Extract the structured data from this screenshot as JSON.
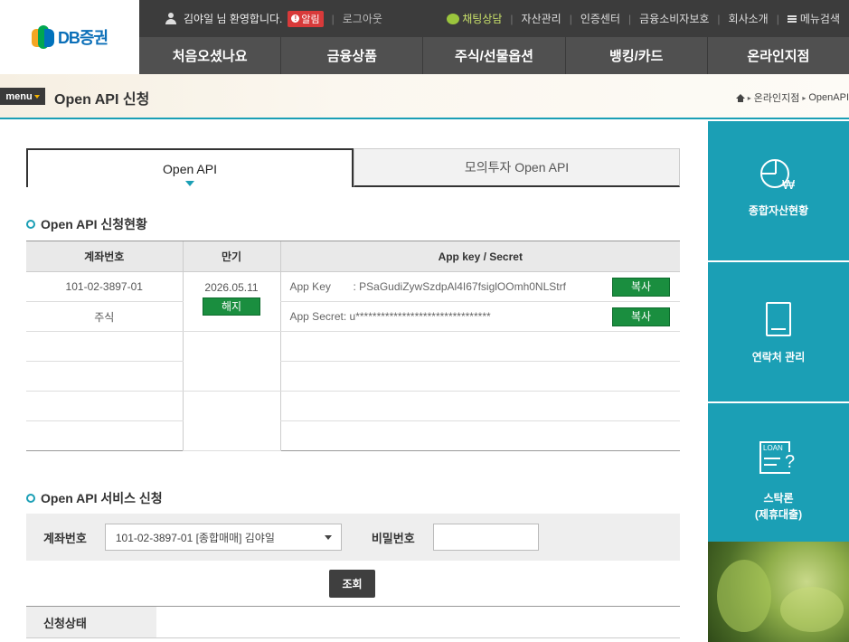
{
  "header": {
    "logo_text": "DB증권",
    "welcome": "김야일 님 환영합니다.",
    "alarm": "알림",
    "logout": "로그아웃",
    "links": [
      "채팅상담",
      "자산관리",
      "인증센터",
      "금융소비자보호",
      "회사소개",
      "메뉴검색"
    ],
    "nav": [
      "처음오셨나요",
      "금융상품",
      "주식/선물옵션",
      "뱅킹/카드",
      "온라인지점"
    ]
  },
  "subbar": {
    "menu_label": "menu",
    "title": "Open API 신청",
    "breadcrumb": [
      "온라인지점",
      "OpenAPI"
    ]
  },
  "tabs": [
    "Open API",
    "모의투자 Open API"
  ],
  "status_section": {
    "title": "Open API 신청현황",
    "headers": [
      "계좌번호",
      "만기",
      "App key / Secret"
    ],
    "account_no": "101-02-3897-01",
    "account_type": "주식",
    "expiry": "2026.05.11",
    "cancel_label": "해지",
    "app_key_label": "App Key",
    "app_key_value": ": PSaGudiZywSzdpAl4I67fsiglOOmh0NLStrf",
    "app_secret_label": "App Secret",
    "app_secret_value": ": u********************************",
    "copy_label": "복사"
  },
  "service_section": {
    "title": "Open API 서비스 신청",
    "account_label": "계좌번호",
    "account_selected": "101-02-3897-01 [종합매매] 김야일",
    "password_label": "비밀번호",
    "search_label": "조회",
    "status_label": "신청상태"
  },
  "side": {
    "asset": "종합자산현황",
    "contact": "연락처 관리",
    "loan_line1": "스탁론",
    "loan_line2": "(제휴대출)",
    "loan_icon_text": "LOAN"
  }
}
